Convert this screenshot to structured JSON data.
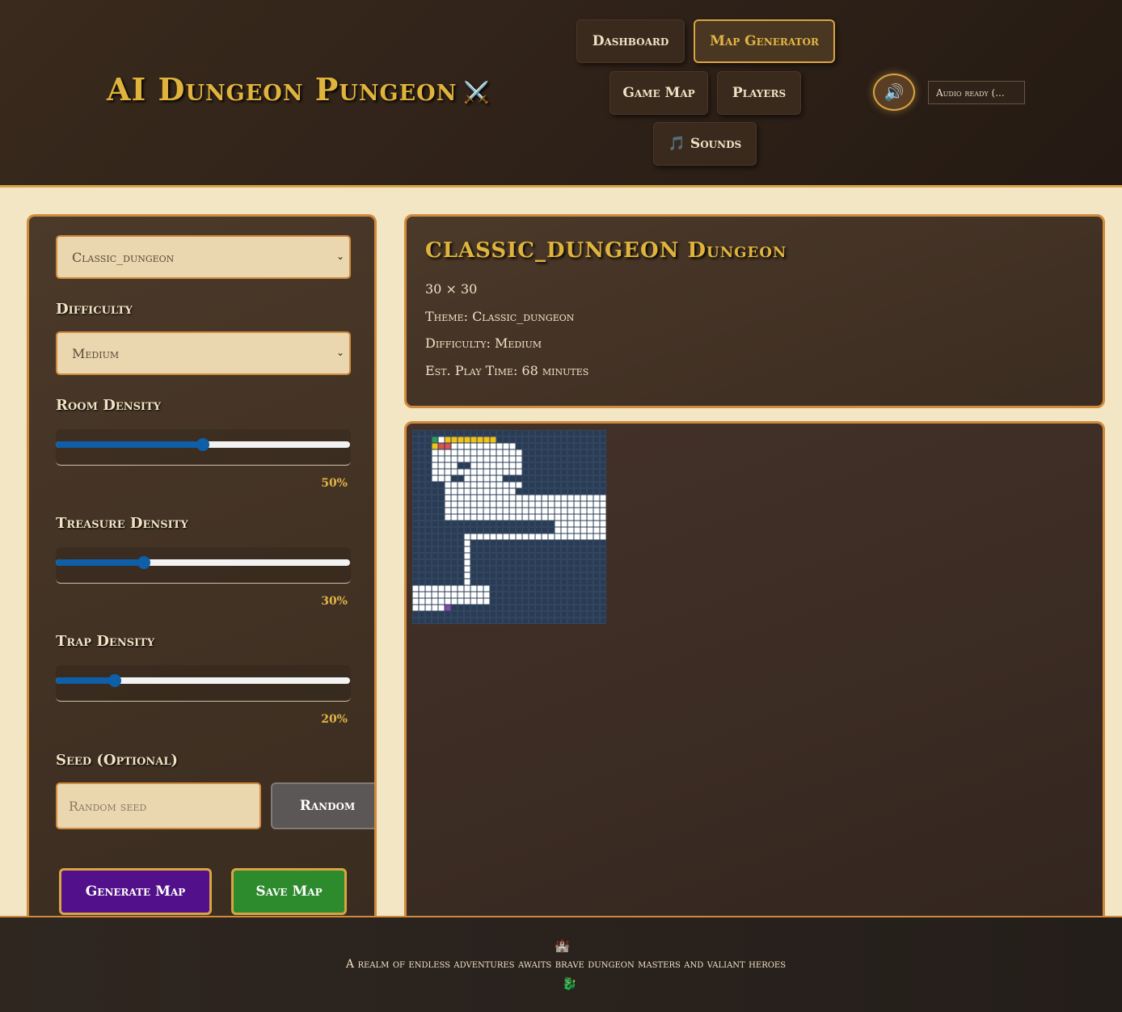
{
  "app": {
    "title": "AI Dungeon Pungeon",
    "title_icon": "⚔️"
  },
  "nav": {
    "dashboard": "Dashboard",
    "map_generator": "Map Generator",
    "game_map": "Game Map",
    "players": "Players",
    "sounds": "🎵 Sounds",
    "active": "map_generator"
  },
  "audio": {
    "toggle_icon": "🔊",
    "status": "Audio ready (..."
  },
  "generator": {
    "theme_value": "Classic_dungeon",
    "difficulty_label": "Difficulty",
    "difficulty_value": "Medium",
    "room_density_label": "Room Density",
    "room_density_value": "50%",
    "room_density_fraction": 0.5,
    "treasure_density_label": "Treasure Density",
    "treasure_density_value": "30%",
    "treasure_density_fraction": 0.3,
    "trap_density_label": "Trap Density",
    "trap_density_value": "20%",
    "trap_density_fraction": 0.2,
    "seed_label": "Seed (Optional)",
    "seed_placeholder": "Random seed",
    "random_button": "Random",
    "generate_button": "Generate Map",
    "save_button": "Save Map"
  },
  "info": {
    "title": "CLASSIC_DUNGEON Dungeon",
    "size": "30 × 30",
    "theme": "Theme: Classic_dungeon",
    "difficulty": "Difficulty: Medium",
    "play_time": "Est. Play Time: 68 minutes"
  },
  "map": {
    "cols": 30,
    "rows": 30,
    "colors": {
      "background": "#2a3c55",
      "grid": "#3a4d66",
      "floor": "#ffffff",
      "start": "#2e9b5a",
      "treasure": "#f1c21b",
      "trap": "#d9534f",
      "exit": "#8e44ad"
    },
    "grid_rows": [
      "..............................",
      "...SFTTTTTTTT.................",
      "...TXXFFFFFFFFFF..............",
      "...FFFFFFFFFFFFFF.............",
      "...FFFFFFFFFFFFFF.............",
      "...FFFF..FFFFFFFF.............",
      "...FFFFFFFFFFFFFF.............",
      "...FFF..FFFFFF................",
      ".....FFFFFFFFFFFF.............",
      ".....FFFFFFFFFFF..............",
      ".....FFFFFFFFFFFFFFFFFFFFFFFFFF",
      ".....FFFFFFFFFFFFFFFFFFFFFFFFFF",
      ".....FFFFFFFFFFFFFFFFFFFFFFFFFF",
      ".....FFFFFFFFFFFFFFFFFFFFFFFFFF",
      "......................FFFFFFFF",
      "......................FFFFFFFF",
      "........FFFFFFFFFFFFFFFFFFFFFF",
      "........F.....................",
      "........F.....................",
      "........F.....................",
      "........F.....................",
      "........F.....................",
      "........F.....................",
      "........F.....................",
      "FFFFFFFFFFFF..................",
      "FFFFFFFFFFFF..................",
      "FFFFFFFFFFFF..................",
      "FFFFFE........................",
      "..............................",
      ".............................."
    ]
  },
  "footer": {
    "castle_icon": "🏰",
    "tagline": "A realm of endless adventures awaits brave dungeon masters and valiant heroes",
    "dragon_icon": "🐉"
  }
}
